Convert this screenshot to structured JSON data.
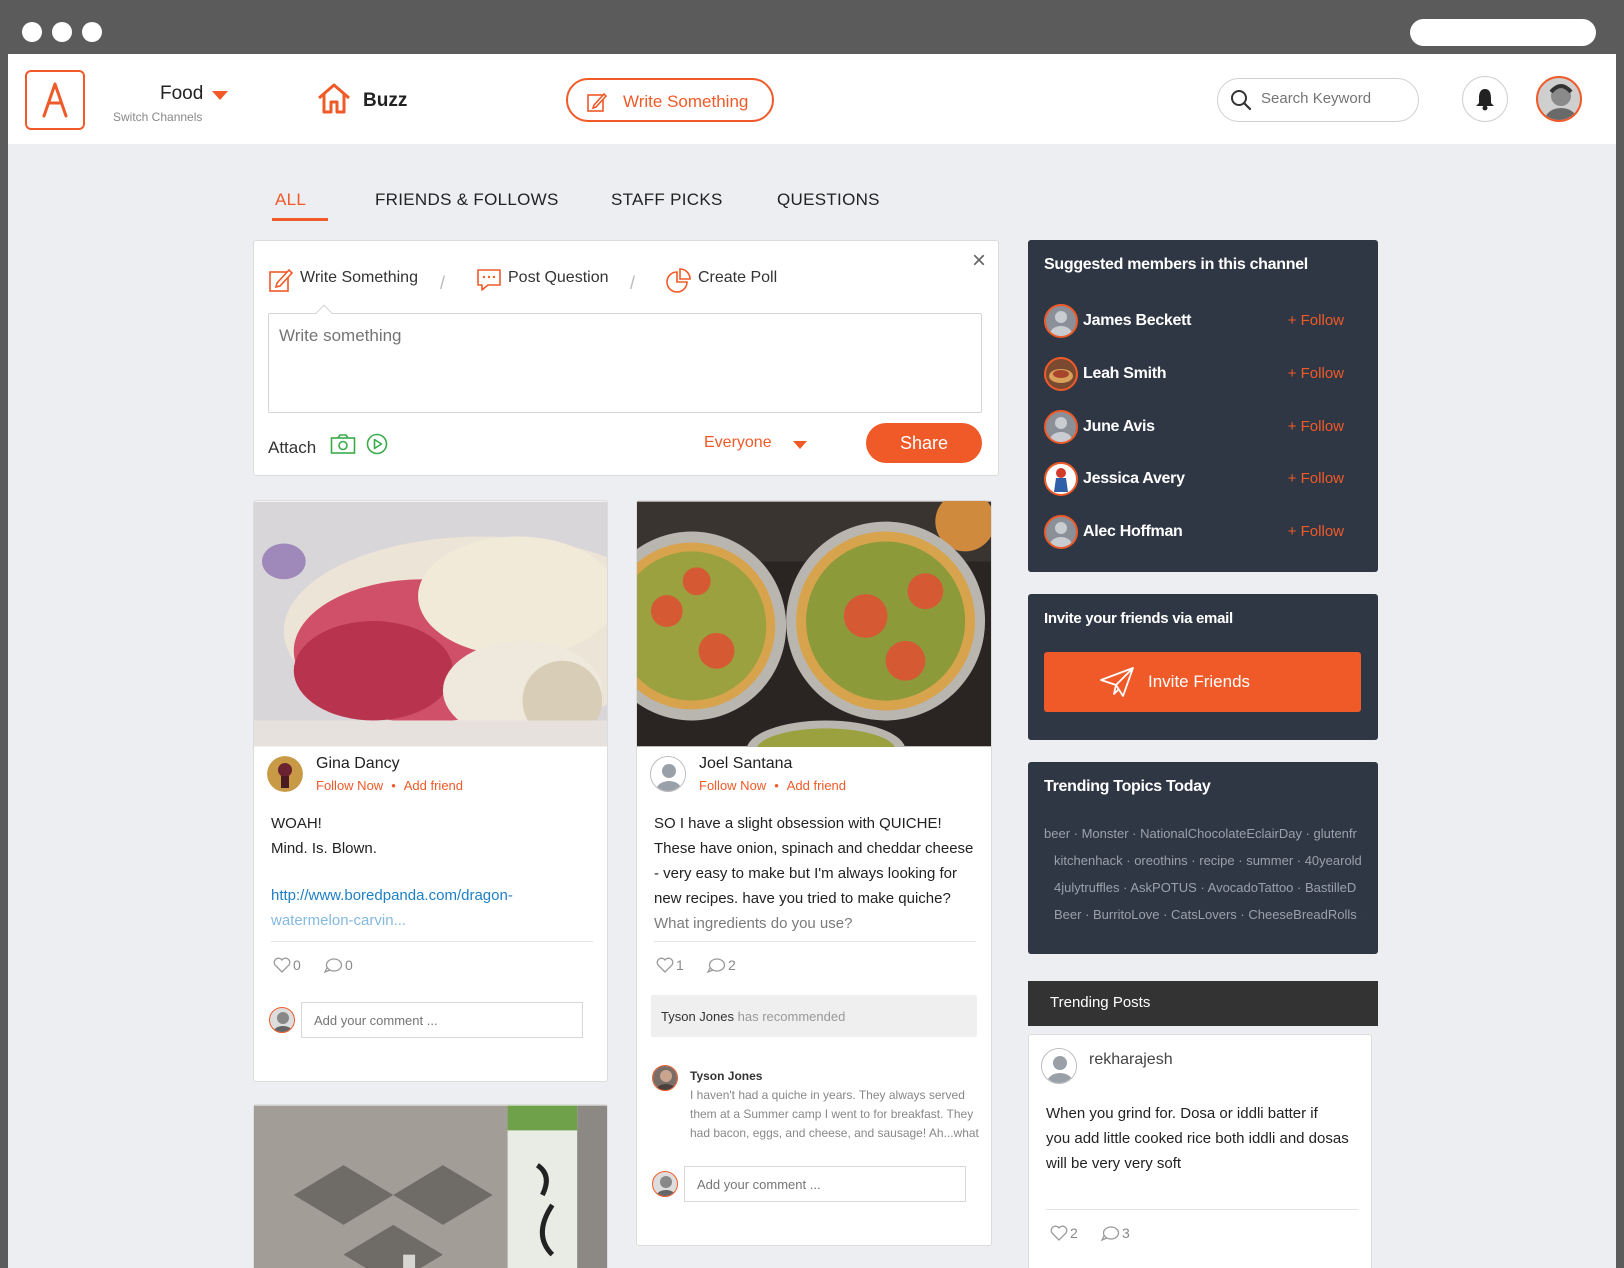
{
  "header": {
    "channel_name": "Food",
    "channel_sub": "Switch Channels",
    "buzz_label": "Buzz",
    "write_label": "Write Something",
    "search_placeholder": "Search Keyword"
  },
  "tabs": [
    "ALL",
    "FRIENDS & FOLLOWS",
    "STAFF PICKS",
    "QUESTIONS"
  ],
  "composer": {
    "opt_write": "Write Something",
    "opt_question": "Post Question",
    "opt_poll": "Create Poll",
    "placeholder": "Write something",
    "attach_label": "Attach",
    "audience": "Everyone",
    "share_label": "Share"
  },
  "posts": [
    {
      "author": "Gina Dancy",
      "follow": "Follow Now",
      "add_friend": "Add friend",
      "line1": "WOAH!",
      "line2": "Mind. Is. Blown.",
      "link1": "http://www.boredpanda.com/dragon-",
      "link2": "watermelon-carvin...",
      "likes": "0",
      "comments": "0",
      "comment_placeholder": "Add your comment ..."
    },
    {
      "author": "Joel Santana",
      "follow": "Follow Now",
      "add_friend": "Add friend",
      "lines": [
        "SO I have a slight obsession with QUICHE!",
        "These have onion, spinach and cheddar cheese",
        "- very easy to make but I'm always looking for",
        "new recipes. have you tried to make quiche?",
        "What ingredients do you use?"
      ],
      "likes": "1",
      "comments": "2",
      "recommended_by": "Tyson Jones",
      "recommended_text": "has recommended",
      "reply_author": "Tyson Jones",
      "reply_lines": [
        "I haven't had a quiche in years. They always served",
        "them at a Summer camp I went to for breakfast. They",
        "had bacon, eggs, and cheese, and sausage! Ah...what"
      ],
      "comment_placeholder": "Add your comment ..."
    }
  ],
  "suggested": {
    "title": "Suggested members in this channel",
    "follow_label": "+ Follow",
    "members": [
      "James Beckett",
      "Leah Smith",
      "June Avis",
      "Jessica Avery",
      "Alec Hoffman"
    ]
  },
  "invite": {
    "title": "Invite your friends via email",
    "button": "Invite Friends"
  },
  "trending_topics": {
    "title": "Trending Topics Today",
    "lines": [
      "beer · Monster · NationalChocolateEclairDay · glutenfr",
      "kitchenhack · oreothins · recipe · summer · 40yearold",
      "4julytruffles · AskPOTUS · AvocadoTattoo · BastilleD",
      "Beer · BurritoLove · CatsLovers · CheeseBreadRolls ·"
    ]
  },
  "trending_posts": {
    "title": "Trending Posts",
    "author": "rekharajesh",
    "lines": [
      "When you grind for. Dosa or iddli batter if",
      "you add little cooked rice both iddli and dosas",
      "will be very very soft"
    ],
    "likes": "2",
    "comments": "3"
  },
  "colors": {
    "accent": "#f05a28",
    "panel": "#2f3744",
    "background": "#eceef1"
  }
}
